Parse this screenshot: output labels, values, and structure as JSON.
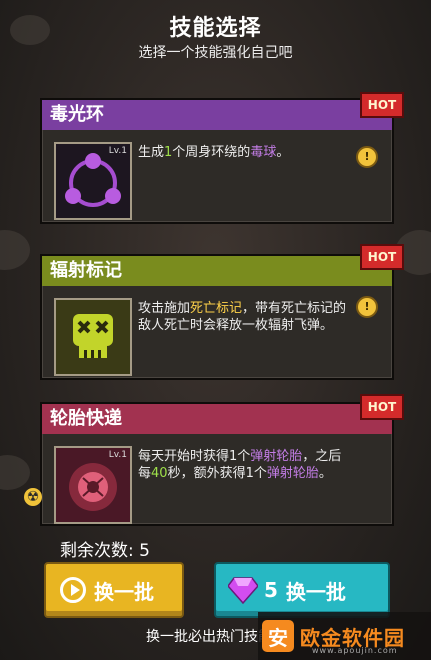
{
  "header": {
    "title": "技能选择",
    "subtitle": "选择一个技能强化自己吧"
  },
  "cards": [
    {
      "name": "毒光环",
      "level": "Lv.1",
      "hot": "HOT",
      "desc_parts": [
        "生成",
        "1",
        "个周身环绕的",
        "毒球",
        "。"
      ]
    },
    {
      "name": "辐射标记",
      "level": "",
      "hot": "HOT",
      "desc_parts": [
        "攻击施加",
        "死亡标记",
        "，带有死亡标记的敌人死亡时会释放一枚辐射飞弹。"
      ]
    },
    {
      "name": "轮胎快递",
      "level": "Lv.1",
      "hot": "HOT",
      "desc_parts": [
        "每天开始时获得1个",
        "弹射轮胎",
        "，之后每",
        "40",
        "秒，额外获得1个",
        "弹射轮胎",
        "。"
      ]
    }
  ],
  "remaining": {
    "label": "剩余次数: 5"
  },
  "buttons": {
    "refresh_free": {
      "label": "换一批"
    },
    "refresh_gem": {
      "cost": "5",
      "label": "换一批"
    }
  },
  "footer": {
    "text": "换一批必出热门技能"
  },
  "watermark": {
    "logo": "安",
    "text": "欧金软件园",
    "sub": "www.apoujin.com"
  },
  "colors": {
    "purple": "#7a3fa0",
    "olive": "#7a8c1e",
    "red": "#a23250",
    "gold": "#e8b522",
    "teal": "#27b8c3",
    "hot": "#d42b2b"
  },
  "icons": [
    "hint-icon",
    "play-icon",
    "gem-icon",
    "poison-orb-icon",
    "skull-icon",
    "tire-icon",
    "radiation-icon"
  ]
}
